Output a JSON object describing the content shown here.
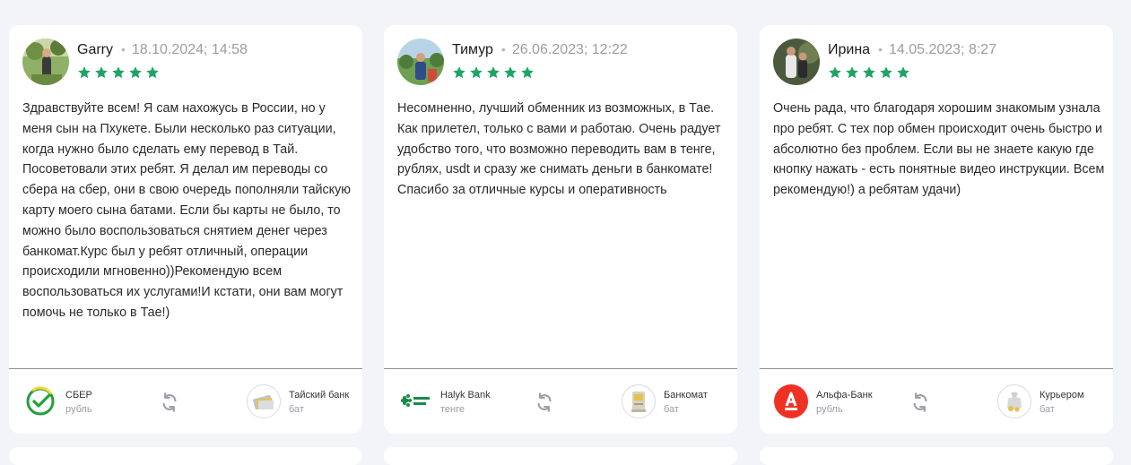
{
  "reviews": [
    {
      "name": "Garry",
      "date": "18.10.2024; 14:58",
      "rating": 5,
      "text": "Здравствуйте всем! Я сам нахожусь в России, но у меня сын на Пхукете. Были несколько раз ситуации, когда нужно было сделать ему перевод в Тай. Посоветовали этих ребят. Я делал им переводы со сбера на сбер, они в свою очередь пополняли тайскую карту моего сына батами. Если бы карты не было, то можно было воспользоваться снятием денег через банкомат.Курс был у ребят отличный, операции происходили мгновенно))Рекомендую всем воспользоваться их услугами!И кстати, они вам могут помочь не только в Тае!)",
      "from": {
        "name": "СБЕР",
        "currency": "рубль",
        "icon": "sber-icon"
      },
      "to": {
        "name": "Тайский банк",
        "currency": "бат",
        "icon": "thai-bank-icon"
      }
    },
    {
      "name": "Тимур",
      "date": "26.06.2023; 12:22",
      "rating": 5,
      "text": "Несомненно, лучший обменник из возможных, в Тае. Как прилетел, только с вами и работаю. Очень радует удобство того, что возможно переводить вам в тенге, рублях, usdt и сразу же снимать деньги в банкомате! Спасибо за отличные курсы и оперативность",
      "from": {
        "name": "Halyk Bank",
        "currency": "тенге",
        "icon": "halyk-bank-icon"
      },
      "to": {
        "name": "Банкомат",
        "currency": "бат",
        "icon": "atm-icon"
      }
    },
    {
      "name": "Ирина",
      "date": "14.05.2023; 8:27",
      "rating": 5,
      "text": "Очень рада, что благодаря хорошим знакомым узнала про ребят. С тех пор обмен происходит очень быстро и абсолютно без проблем. Если вы не знаете какую где кнопку нажать - есть понятные видео инструкции. Всем рекомендую!) а ребятам удачи)",
      "from": {
        "name": "Альфа-Банк",
        "currency": "рубль",
        "icon": "alfa-bank-icon"
      },
      "to": {
        "name": "Курьером",
        "currency": "бат",
        "icon": "courier-icon"
      }
    }
  ],
  "colors": {
    "star": "#1fa463",
    "background": "#f3f4f8",
    "card": "#ffffff",
    "alfa": "#ef3124"
  }
}
